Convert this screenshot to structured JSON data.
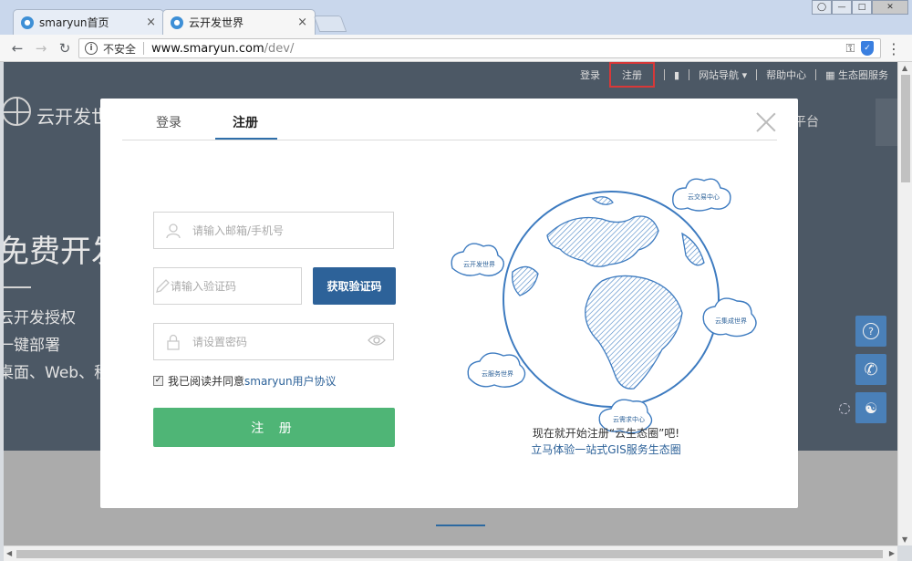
{
  "browser": {
    "tabs": [
      {
        "label": "smaryun首页",
        "close": "×"
      },
      {
        "label": "云开发世界",
        "close": "×"
      }
    ],
    "address": {
      "security_label": "不安全",
      "host": "www.smaryun.com",
      "path": "/dev/"
    }
  },
  "site": {
    "top_nav": {
      "login": "登录",
      "register": "注册",
      "site_nav": "网站导航",
      "help": "帮助中心",
      "ecosystem": "生态圈服务"
    },
    "name": "云开发世",
    "platform_text": "平台",
    "hero": {
      "title": "免费开发",
      "feature1": "云开发授权",
      "feature2": "一键部署",
      "feature3": "桌面、Web、移"
    }
  },
  "modal": {
    "tabs": {
      "login": "登录",
      "register": "注册"
    },
    "email_placeholder": "请输入邮箱/手机号",
    "code_placeholder": "请输入验证码",
    "get_code_label": "获取验证码",
    "password_placeholder": "请设置密码",
    "agreement_text": "我已阅读并同意",
    "agreement_link": "smaryun用户协议",
    "submit_label": "注 册",
    "globe_labels": [
      "云交易中心",
      "云开发世界",
      "云集成世界",
      "云服务世界",
      "云需求中心"
    ],
    "promo_line1": "现在就开始注册“云生态圈”吧!",
    "promo_line2": "立马体验一站式GIS服务生态圈"
  },
  "colors": {
    "primary_blue": "#2d6299",
    "green": "#4fb576",
    "page_dark": "#515d6b",
    "highlight_red": "#e43b3b"
  }
}
